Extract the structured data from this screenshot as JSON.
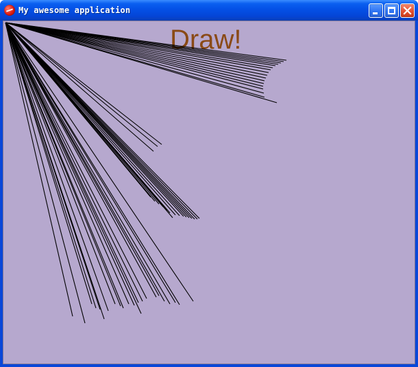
{
  "window": {
    "title": "My awesome application",
    "minimize_label": "",
    "maximize_label": "",
    "close_label": ""
  },
  "canvas": {
    "heading": "Draw!",
    "background_color": "#b6a8ce",
    "heading_color": "#8a4a16",
    "line_color": "#000000"
  }
}
